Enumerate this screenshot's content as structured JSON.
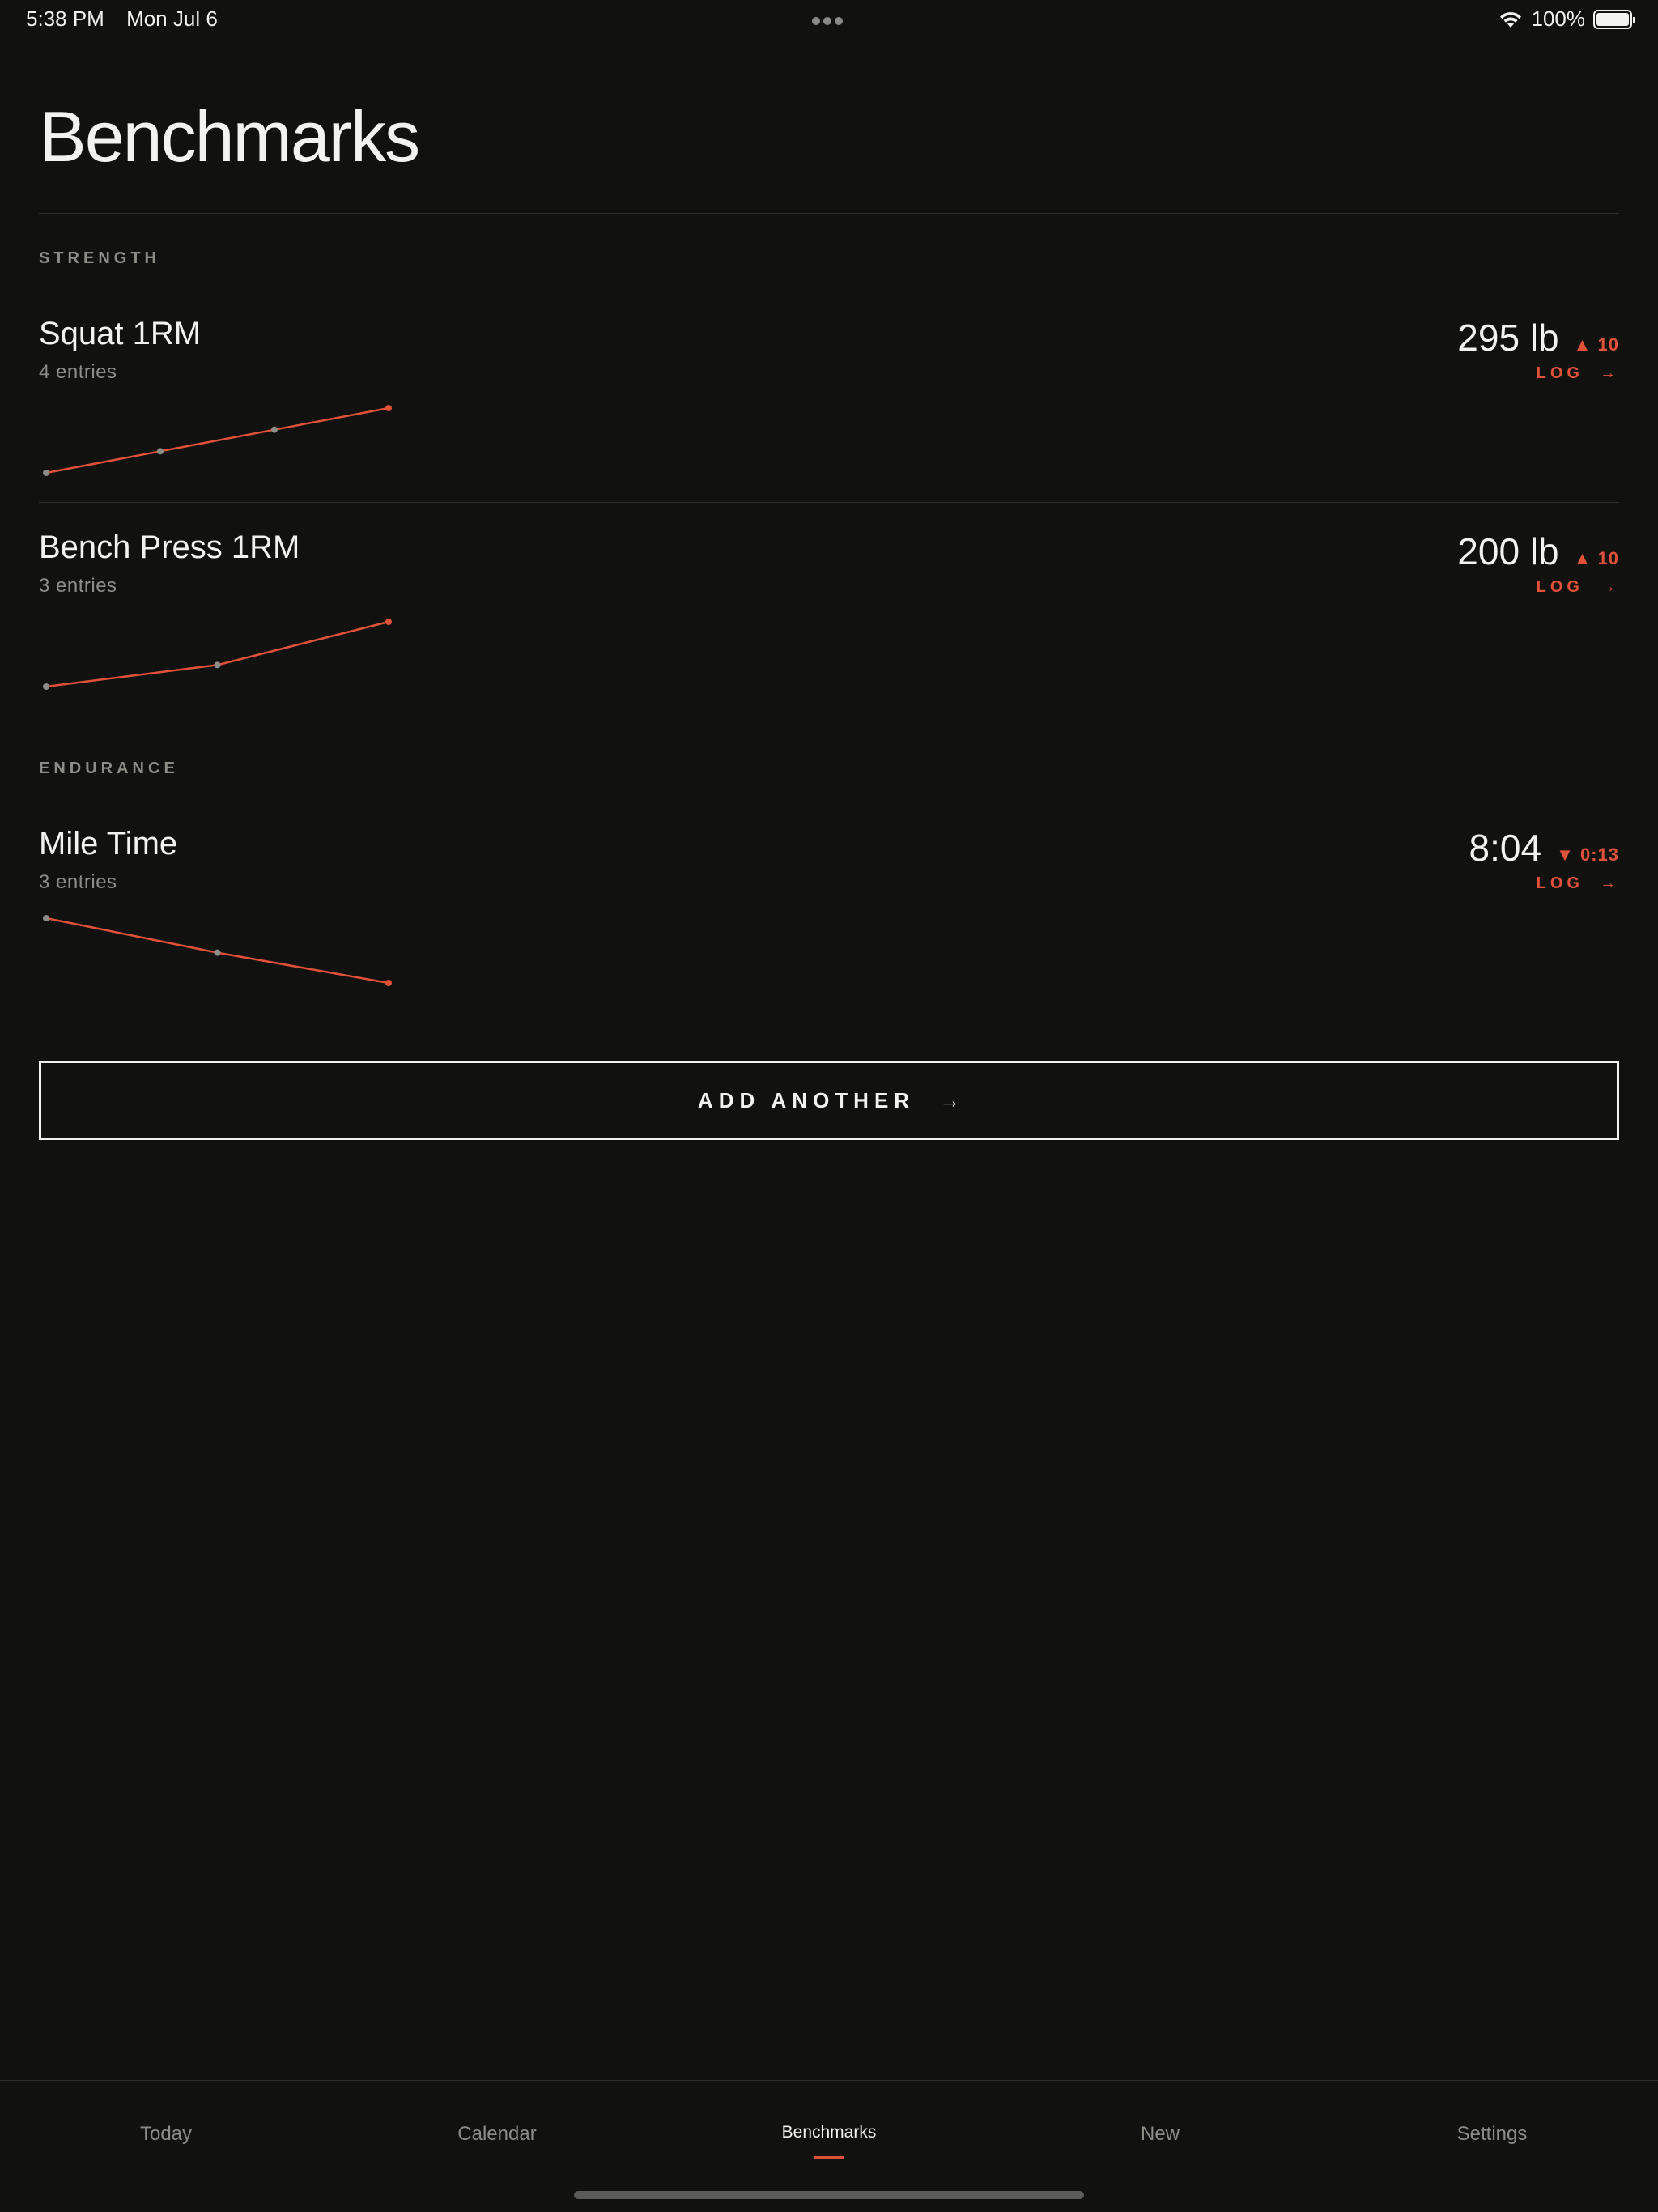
{
  "status_bar": {
    "time": "5:38 PM",
    "date": "Mon Jul 6",
    "battery": "100%",
    "icons": [
      "wifi-icon",
      "battery-icon",
      "more-dots-icon"
    ]
  },
  "page": {
    "title": "Benchmarks"
  },
  "sections": {
    "strength": "STRENGTH",
    "endurance": "ENDURANCE"
  },
  "benchmarks": [
    {
      "name": "Squat 1RM",
      "entries": "4 entries",
      "value": "295 lb",
      "delta": "▲ 10",
      "log_label": "LOG",
      "trend": [
        1,
        2,
        3,
        4
      ]
    },
    {
      "name": "Bench Press 1RM",
      "entries": "3 entries",
      "value": "200 lb",
      "delta": "▲ 10",
      "log_label": "LOG",
      "trend": [
        0,
        1,
        3
      ]
    },
    {
      "name": "Mile Time",
      "entries": "3 entries",
      "value": "8:04",
      "delta": "▼ 0:13",
      "log_label": "LOG",
      "trend": [
        3,
        1.4,
        0
      ]
    }
  ],
  "add_button": {
    "label": "ADD ANOTHER"
  },
  "tabs": [
    {
      "label": "Today"
    },
    {
      "label": "Calendar"
    },
    {
      "label": "Benchmarks",
      "active": true
    },
    {
      "label": "New"
    },
    {
      "label": "Settings"
    }
  ],
  "colors": {
    "background": "#111110",
    "accent": "#e0513a",
    "muted": "#8d8d87",
    "text": "#f2f2ef"
  }
}
